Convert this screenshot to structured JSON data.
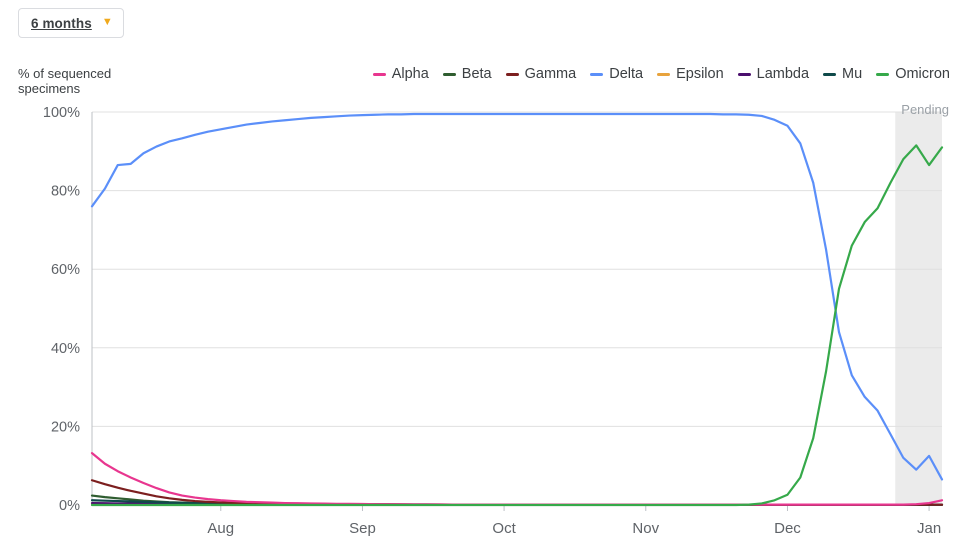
{
  "range_selector": {
    "label": "6 months",
    "chevron_icon": "chevron-down-icon"
  },
  "y_caption": "% of sequenced specimens",
  "pending_label": "Pending",
  "legend": [
    {
      "name": "Alpha",
      "color": "#e8368f"
    },
    {
      "name": "Beta",
      "color": "#2f5d30"
    },
    {
      "name": "Gamma",
      "color": "#7c1f1f"
    },
    {
      "name": "Delta",
      "color": "#5b8ff9"
    },
    {
      "name": "Epsilon",
      "color": "#e8a33d"
    },
    {
      "name": "Lambda",
      "color": "#4b0f6e"
    },
    {
      "name": "Mu",
      "color": "#0f4a4a"
    },
    {
      "name": "Omicron",
      "color": "#36a94a"
    }
  ],
  "chart_data": {
    "type": "line",
    "title": "",
    "xlabel": "",
    "ylabel": "% of sequenced specimens",
    "ylim": [
      0,
      100
    ],
    "ytick_labels": [
      "0%",
      "20%",
      "40%",
      "60%",
      "80%",
      "100%"
    ],
    "ytick_values": [
      0,
      20,
      40,
      60,
      80,
      100
    ],
    "xtick_labels": [
      "Aug",
      "Sep",
      "Oct",
      "Nov",
      "Dec",
      "Jan"
    ],
    "xtick_positions": [
      0.1515,
      0.3182,
      0.4848,
      0.6515,
      0.8182,
      0.9848
    ],
    "grid": "horizontal",
    "legend_position": "top-right",
    "annotations": [
      {
        "text": "Pending",
        "type": "shaded-region",
        "x_start": 0.945,
        "x_end": 1.0
      }
    ],
    "x": [
      0,
      0.0152,
      0.0303,
      0.0455,
      0.0606,
      0.0758,
      0.0909,
      0.1061,
      0.1212,
      0.1364,
      0.1515,
      0.1667,
      0.1818,
      0.197,
      0.2121,
      0.2273,
      0.2424,
      0.2576,
      0.2727,
      0.2879,
      0.303,
      0.3182,
      0.3333,
      0.3485,
      0.3636,
      0.3788,
      0.3939,
      0.4091,
      0.4242,
      0.4394,
      0.4545,
      0.4697,
      0.4848,
      0.5,
      0.5152,
      0.5303,
      0.5455,
      0.5606,
      0.5758,
      0.5909,
      0.6061,
      0.6212,
      0.6364,
      0.6515,
      0.6667,
      0.6818,
      0.697,
      0.7121,
      0.7273,
      0.7424,
      0.7576,
      0.7727,
      0.7879,
      0.803,
      0.8182,
      0.8333,
      0.8485,
      0.8636,
      0.8788,
      0.8939,
      0.9091,
      0.9242,
      0.9394,
      0.9545,
      0.9697,
      0.9848,
      1.0
    ],
    "series": [
      {
        "name": "Alpha",
        "color": "#e8368f",
        "values": [
          13.2,
          10.5,
          8.6,
          7.0,
          5.6,
          4.3,
          3.2,
          2.4,
          1.9,
          1.5,
          1.2,
          1.0,
          0.8,
          0.7,
          0.6,
          0.5,
          0.45,
          0.4,
          0.35,
          0.3,
          0.3,
          0.25,
          0.2,
          0.2,
          0.2,
          0.15,
          0.15,
          0.15,
          0.1,
          0.1,
          0.1,
          0.1,
          0.1,
          0.1,
          0.1,
          0.1,
          0.1,
          0.1,
          0.1,
          0.1,
          0.1,
          0.1,
          0.1,
          0.1,
          0.1,
          0.1,
          0.1,
          0.1,
          0.1,
          0.1,
          0.1,
          0.1,
          0.1,
          0.1,
          0.1,
          0.1,
          0.1,
          0.1,
          0.1,
          0.1,
          0.1,
          0.1,
          0.1,
          0.1,
          0.2,
          0.5,
          1.2
        ]
      },
      {
        "name": "Beta",
        "color": "#2f5d30",
        "values": [
          2.4,
          2.0,
          1.7,
          1.4,
          1.1,
          0.9,
          0.7,
          0.6,
          0.5,
          0.4,
          0.35,
          0.3,
          0.25,
          0.2,
          0.2,
          0.18,
          0.15,
          0.15,
          0.12,
          0.1,
          0.1,
          0.1,
          0.1,
          0.1,
          0.1,
          0.08,
          0.08,
          0.08,
          0.06,
          0.06,
          0.06,
          0.05,
          0.05,
          0.05,
          0.05,
          0.05,
          0.05,
          0.05,
          0.05,
          0.05,
          0.05,
          0.05,
          0.05,
          0.05,
          0.05,
          0.05,
          0.05,
          0.05,
          0.05,
          0.05,
          0.05,
          0.05,
          0.05,
          0.05,
          0.05,
          0.05,
          0.05,
          0.05,
          0.05,
          0.05,
          0.05,
          0.05,
          0.05,
          0.05,
          0.05,
          0.05,
          0.05
        ]
      },
      {
        "name": "Gamma",
        "color": "#7c1f1f",
        "values": [
          6.3,
          5.3,
          4.4,
          3.6,
          2.9,
          2.2,
          1.7,
          1.3,
          1.0,
          0.8,
          0.65,
          0.55,
          0.45,
          0.4,
          0.35,
          0.3,
          0.28,
          0.25,
          0.22,
          0.2,
          0.2,
          0.18,
          0.15,
          0.15,
          0.12,
          0.1,
          0.1,
          0.1,
          0.1,
          0.1,
          0.1,
          0.08,
          0.08,
          0.08,
          0.08,
          0.08,
          0.08,
          0.08,
          0.08,
          0.08,
          0.08,
          0.08,
          0.08,
          0.08,
          0.08,
          0.08,
          0.08,
          0.08,
          0.08,
          0.08,
          0.08,
          0.08,
          0.08,
          0.08,
          0.08,
          0.08,
          0.08,
          0.08,
          0.08,
          0.08,
          0.08,
          0.08,
          0.08,
          0.08,
          0.08,
          0.08,
          0.08
        ]
      },
      {
        "name": "Delta",
        "color": "#5b8ff9",
        "values": [
          76.0,
          80.5,
          86.5,
          86.8,
          89.5,
          91.2,
          92.5,
          93.3,
          94.2,
          95.0,
          95.6,
          96.2,
          96.8,
          97.2,
          97.6,
          97.9,
          98.2,
          98.5,
          98.7,
          98.9,
          99.1,
          99.2,
          99.3,
          99.4,
          99.4,
          99.5,
          99.5,
          99.5,
          99.5,
          99.5,
          99.5,
          99.5,
          99.5,
          99.5,
          99.5,
          99.5,
          99.5,
          99.5,
          99.5,
          99.5,
          99.5,
          99.5,
          99.5,
          99.5,
          99.5,
          99.5,
          99.5,
          99.5,
          99.5,
          99.4,
          99.4,
          99.3,
          99.0,
          98.0,
          96.5,
          92.0,
          82.0,
          65.0,
          44.0,
          33.0,
          27.5,
          24.0,
          18.0,
          12.0,
          9.0,
          12.5,
          6.5
        ]
      },
      {
        "name": "Epsilon",
        "color": "#e8a33d",
        "values": [
          0.3,
          0.25,
          0.2,
          0.18,
          0.15,
          0.12,
          0.1,
          0.1,
          0.08,
          0.08,
          0.06,
          0.06,
          0.05,
          0.05,
          0.05,
          0.05,
          0.05,
          0.05,
          0.05,
          0.05,
          0.05,
          0.05,
          0.05,
          0.05,
          0.05,
          0.05,
          0.05,
          0.05,
          0.05,
          0.05,
          0.05,
          0.05,
          0.05,
          0.05,
          0.05,
          0.05,
          0.05,
          0.05,
          0.05,
          0.05,
          0.05,
          0.05,
          0.05,
          0.05,
          0.05,
          0.05,
          0.05,
          0.05,
          0.05,
          0.05,
          0.05,
          0.05,
          0.05,
          0.05,
          0.05,
          0.05,
          0.05,
          0.05,
          0.05,
          0.05,
          0.05,
          0.05,
          0.05,
          0.05,
          0.05,
          0.05,
          0.05
        ]
      },
      {
        "name": "Lambda",
        "color": "#4b0f6e",
        "values": [
          0.5,
          0.45,
          0.4,
          0.38,
          0.35,
          0.32,
          0.3,
          0.28,
          0.25,
          0.22,
          0.2,
          0.2,
          0.18,
          0.15,
          0.15,
          0.12,
          0.12,
          0.1,
          0.1,
          0.1,
          0.1,
          0.1,
          0.08,
          0.08,
          0.08,
          0.06,
          0.06,
          0.06,
          0.05,
          0.05,
          0.05,
          0.05,
          0.05,
          0.05,
          0.05,
          0.05,
          0.05,
          0.05,
          0.05,
          0.05,
          0.05,
          0.05,
          0.05,
          0.05,
          0.05,
          0.05,
          0.05,
          0.05,
          0.05,
          0.05,
          0.05,
          0.05,
          0.05,
          0.05,
          0.05,
          0.05,
          0.05,
          0.05,
          0.05,
          0.05,
          0.05,
          0.05,
          0.05,
          0.05,
          0.05,
          0.05,
          0.05
        ]
      },
      {
        "name": "Mu",
        "color": "#0f4a4a",
        "values": [
          1.2,
          1.1,
          1.0,
          0.9,
          0.8,
          0.7,
          0.6,
          0.55,
          0.5,
          0.45,
          0.4,
          0.38,
          0.35,
          0.32,
          0.3,
          0.28,
          0.26,
          0.24,
          0.22,
          0.2,
          0.2,
          0.18,
          0.16,
          0.15,
          0.14,
          0.12,
          0.12,
          0.1,
          0.1,
          0.1,
          0.1,
          0.1,
          0.1,
          0.1,
          0.1,
          0.1,
          0.1,
          0.1,
          0.1,
          0.1,
          0.1,
          0.1,
          0.1,
          0.1,
          0.1,
          0.1,
          0.1,
          0.1,
          0.1,
          0.1,
          0.1,
          0.1,
          0.1,
          0.1,
          0.1,
          0.1,
          0.1,
          0.1,
          0.1,
          0.1,
          0.1,
          0.1,
          0.1,
          0.1,
          0.1,
          0.1,
          0.1
        ]
      },
      {
        "name": "Omicron",
        "color": "#36a94a",
        "values": [
          0,
          0,
          0,
          0,
          0,
          0,
          0,
          0,
          0,
          0,
          0,
          0,
          0,
          0,
          0,
          0,
          0,
          0,
          0,
          0,
          0,
          0,
          0,
          0,
          0,
          0,
          0,
          0,
          0,
          0,
          0,
          0,
          0,
          0,
          0,
          0,
          0,
          0,
          0,
          0,
          0,
          0,
          0,
          0,
          0,
          0,
          0,
          0,
          0,
          0,
          0,
          0.1,
          0.4,
          1.2,
          2.6,
          7.0,
          17.0,
          34.0,
          55.0,
          66.0,
          72.0,
          75.5,
          82.0,
          88.0,
          91.5,
          86.5,
          91.0
        ]
      }
    ]
  }
}
